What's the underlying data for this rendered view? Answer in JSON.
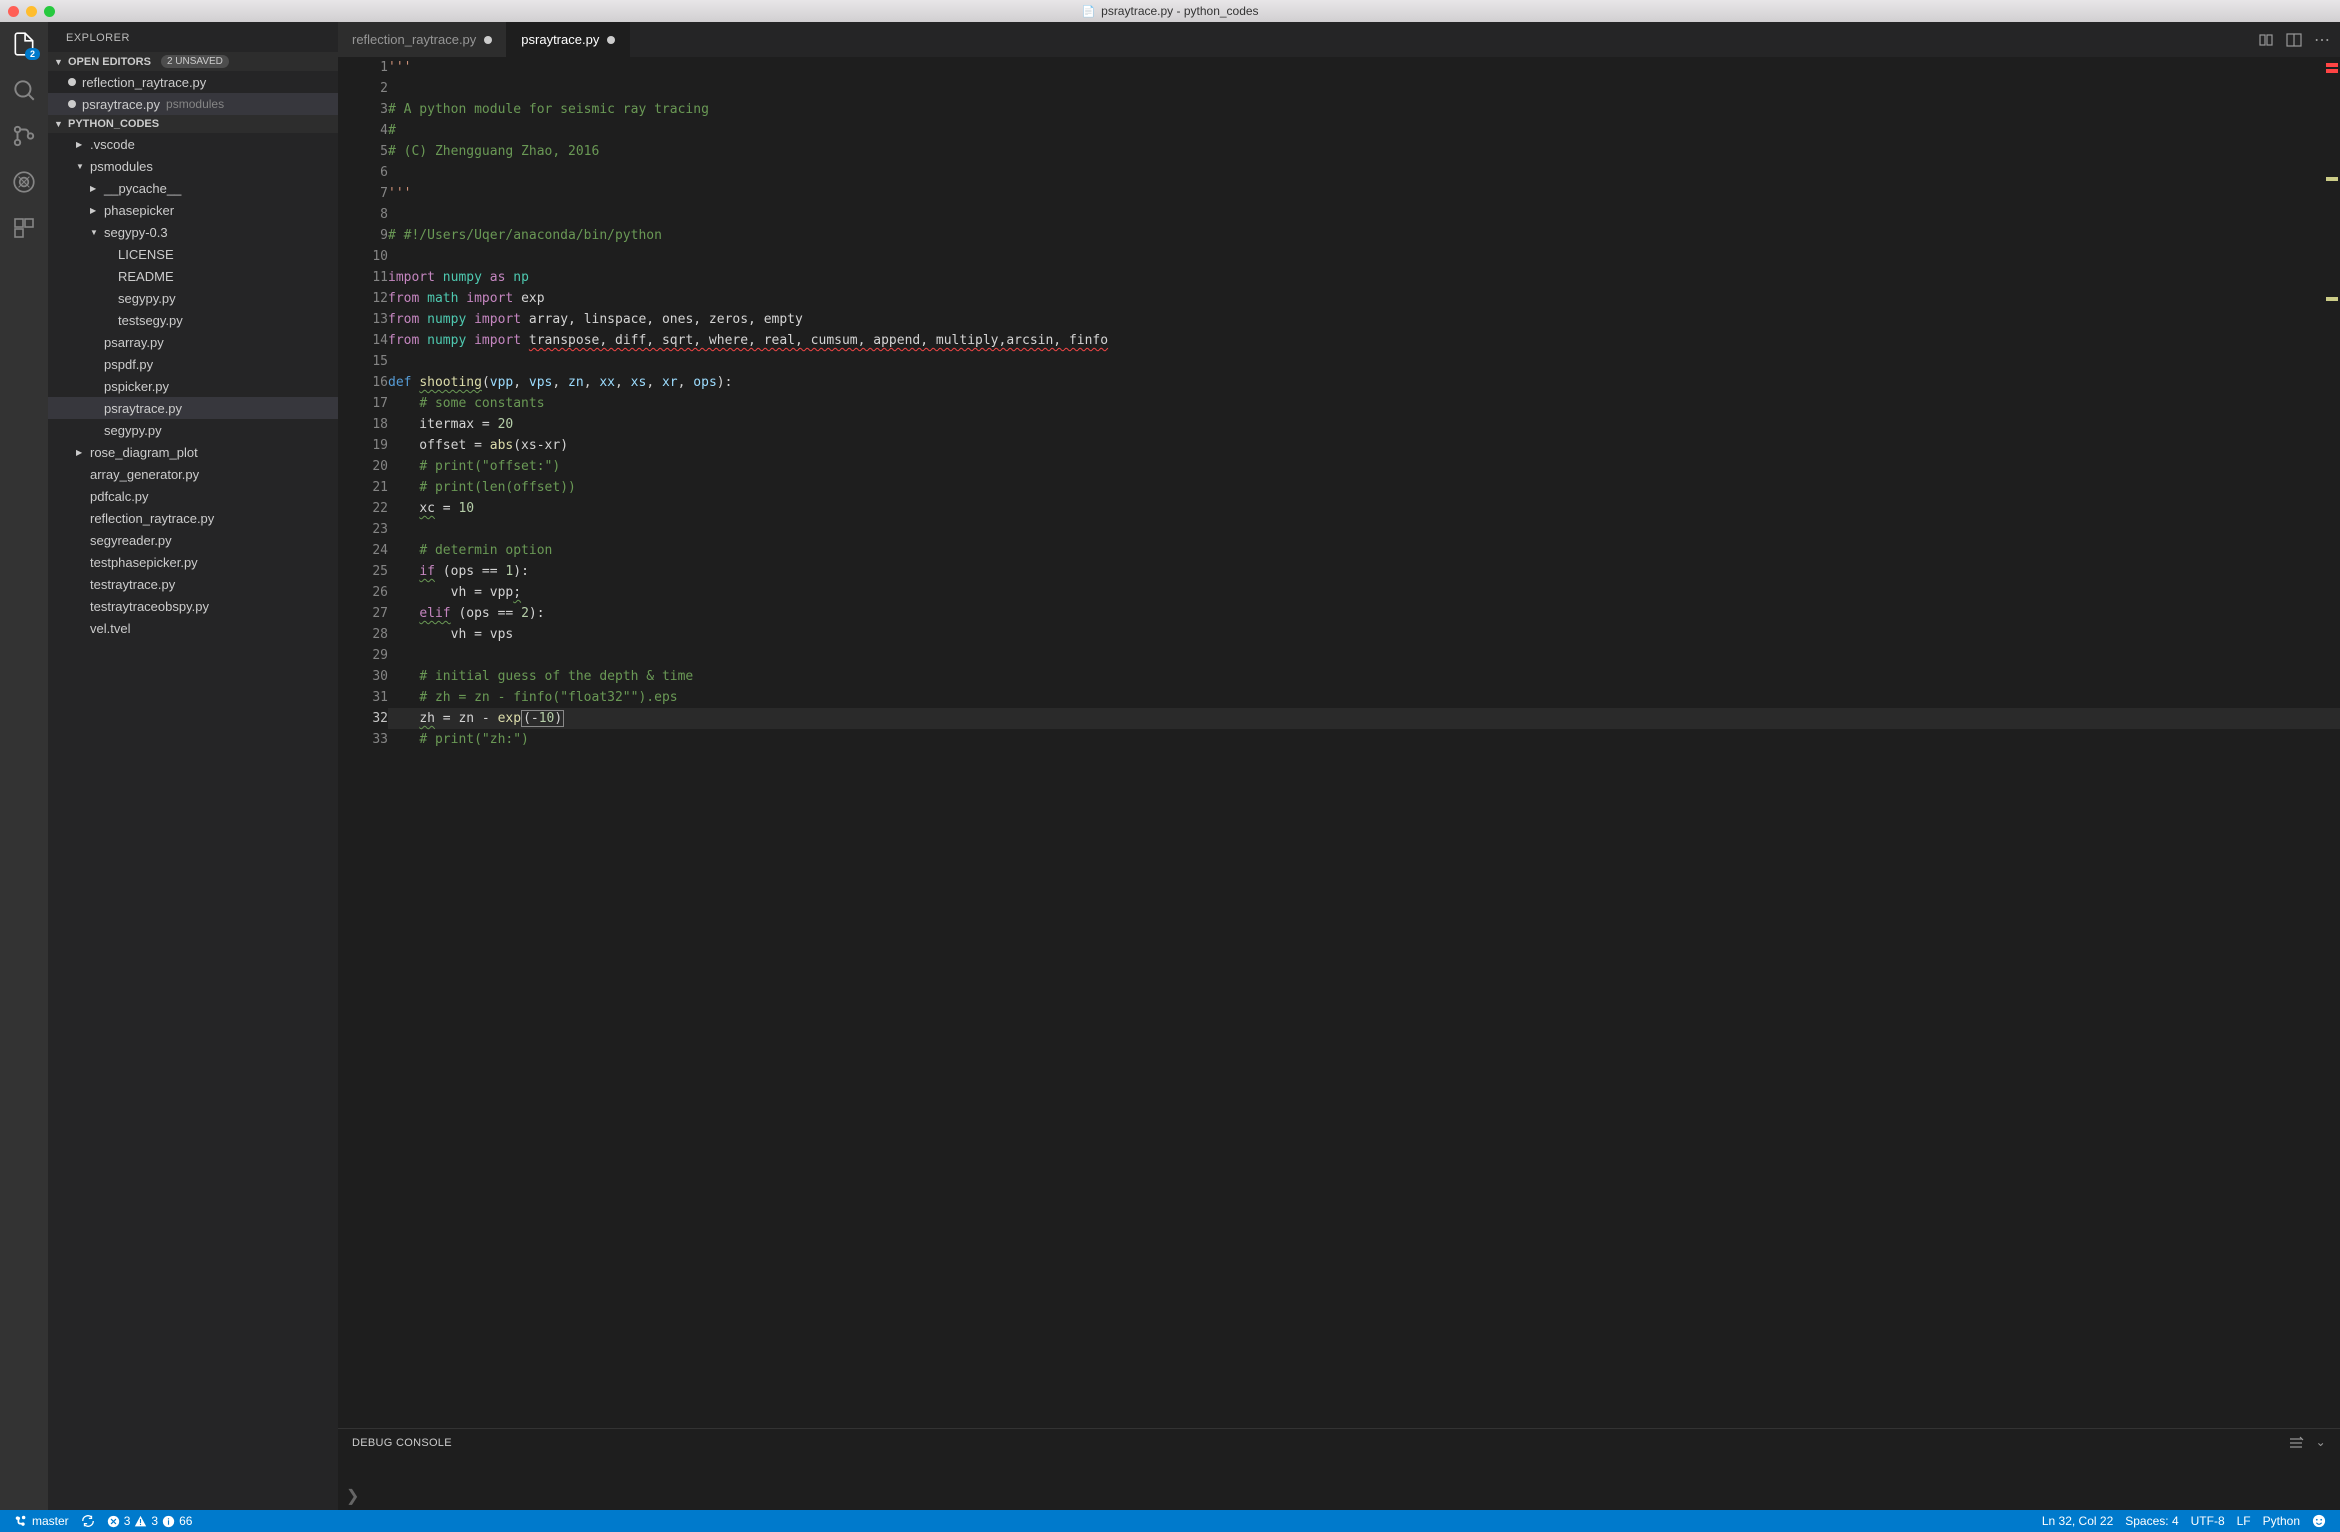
{
  "window_title": "psraytrace.py - python_codes",
  "explorer_title": "EXPLORER",
  "open_editors": {
    "label": "OPEN EDITORS",
    "badge": "2 UNSAVED",
    "items": [
      {
        "name": "reflection_raytrace.py",
        "dim": ""
      },
      {
        "name": "psraytrace.py",
        "dim": "psmodules"
      }
    ]
  },
  "workspace": {
    "name": "PYTHON_CODES",
    "tree": [
      {
        "label": ".vscode",
        "indent": 1,
        "chev": "▶"
      },
      {
        "label": "psmodules",
        "indent": 1,
        "chev": "▼"
      },
      {
        "label": "__pycache__",
        "indent": 2,
        "chev": "▶"
      },
      {
        "label": "phasepicker",
        "indent": 2,
        "chev": "▶"
      },
      {
        "label": "segypy-0.3",
        "indent": 2,
        "chev": "▼"
      },
      {
        "label": "LICENSE",
        "indent": 3
      },
      {
        "label": "README",
        "indent": 3
      },
      {
        "label": "segypy.py",
        "indent": 3
      },
      {
        "label": "testsegy.py",
        "indent": 3
      },
      {
        "label": "psarray.py",
        "indent": 2
      },
      {
        "label": "pspdf.py",
        "indent": 2
      },
      {
        "label": "pspicker.py",
        "indent": 2
      },
      {
        "label": "psraytrace.py",
        "indent": 2,
        "selected": true
      },
      {
        "label": "segypy.py",
        "indent": 2
      },
      {
        "label": "rose_diagram_plot",
        "indent": 1,
        "chev": "▶"
      },
      {
        "label": "array_generator.py",
        "indent": 1
      },
      {
        "label": "pdfcalc.py",
        "indent": 1
      },
      {
        "label": "reflection_raytrace.py",
        "indent": 1
      },
      {
        "label": "segyreader.py",
        "indent": 1
      },
      {
        "label": "testphasepicker.py",
        "indent": 1
      },
      {
        "label": "testraytrace.py",
        "indent": 1
      },
      {
        "label": "testraytraceobspy.py",
        "indent": 1
      },
      {
        "label": "vel.tvel",
        "indent": 1
      }
    ]
  },
  "tabs": [
    {
      "label": "reflection_raytrace.py",
      "modified": true,
      "active": false
    },
    {
      "label": "psraytrace.py",
      "modified": true,
      "active": true
    }
  ],
  "activity_badge": "2",
  "code_lines": [
    {
      "n": 1,
      "html": "<span class='str'>'''</span>"
    },
    {
      "n": 2,
      "html": ""
    },
    {
      "n": 3,
      "html": "<span class='cmt'># A python module for seismic ray tracing</span>"
    },
    {
      "n": 4,
      "html": "<span class='cmt'>#</span>"
    },
    {
      "n": 5,
      "html": "<span class='cmt'># (C) Zhengguang Zhao, 2016</span>"
    },
    {
      "n": 6,
      "html": ""
    },
    {
      "n": 7,
      "html": "<span class='str'>'''</span>"
    },
    {
      "n": 8,
      "html": ""
    },
    {
      "n": 9,
      "html": "<span class='cmt'># #!/Users/Uqer/anaconda/bin/python</span>"
    },
    {
      "n": 10,
      "html": ""
    },
    {
      "n": 11,
      "html": "<span class='kw2'>import</span> <span class='cls'>numpy</span> <span class='kw2'>as</span> <span class='cls'>np</span>"
    },
    {
      "n": 12,
      "html": "<span class='kw2'>from</span> <span class='cls'>math</span> <span class='kw2'>import</span> exp"
    },
    {
      "n": 13,
      "html": "<span class='kw2'>from</span> <span class='cls'>numpy</span> <span class='kw2'>import</span> array, linspace, ones, zeros, empty"
    },
    {
      "n": 14,
      "html": "<span class='kw2'>from</span> <span class='cls'>numpy</span> <span class='kw2'>import</span> <span class='wavy-r'>transpose, diff, sqrt, where, real, cumsum, append, multiply,arcsin, finfo</span>"
    },
    {
      "n": 15,
      "html": ""
    },
    {
      "n": 16,
      "html": "<span class='kw'>def</span> <span class='fn wavy-g'>shooting</span>(<span class='var'>vpp</span>, <span class='var'>vps</span>, <span class='var'>zn</span>, <span class='var'>xx</span>, <span class='var'>xs</span>, <span class='var'>xr</span>, <span class='var'>ops</span>):"
    },
    {
      "n": 17,
      "html": "    <span class='cmt'># some constants</span>"
    },
    {
      "n": 18,
      "html": "    itermax = <span class='num'>20</span>"
    },
    {
      "n": 19,
      "html": "    offset = <span class='fn'>abs</span>(xs-xr)"
    },
    {
      "n": 20,
      "html": "    <span class='cmt'># print(\"offset:\")</span>"
    },
    {
      "n": 21,
      "html": "    <span class='cmt'># print(len(offset))</span>"
    },
    {
      "n": 22,
      "html": "    <span class='wavy-g'>xc</span> = <span class='num'>10</span>"
    },
    {
      "n": 23,
      "html": ""
    },
    {
      "n": 24,
      "html": "    <span class='cmt'># determin option</span>"
    },
    {
      "n": 25,
      "html": "    <span class='kw2 wavy-g'>if</span> (ops == <span class='num'>1</span>):"
    },
    {
      "n": 26,
      "html": "        vh = vpp<span class='wavy-g'>;</span>"
    },
    {
      "n": 27,
      "html": "    <span class='kw2 wavy-g'>elif</span> (ops == <span class='num'>2</span>):"
    },
    {
      "n": 28,
      "html": "        vh = vps"
    },
    {
      "n": 29,
      "html": ""
    },
    {
      "n": 30,
      "html": "    <span class='cmt'># initial guess of the depth &amp; time</span>"
    },
    {
      "n": 31,
      "html": "    <span class='cmt'># zh = zn - finfo(\"float32\"\").eps</span>"
    },
    {
      "n": 32,
      "html": "    <span class='wavy-g'>zh</span> = zn - <span class='fn'>exp</span><span class='boxsel'>(-<span class='num'>10</span>)</span>",
      "cur": true
    },
    {
      "n": 33,
      "html": "    <span class='cmt'># print(\"zh:\")</span>"
    }
  ],
  "panel_title": "DEBUG CONSOLE",
  "prompt": "❯",
  "status": {
    "branch": "master",
    "errors": "3",
    "warnings": "3",
    "info": "66",
    "cursor": "Ln 32, Col 22",
    "spaces": "Spaces: 4",
    "encoding": "UTF-8",
    "eol": "LF",
    "lang": "Python"
  }
}
